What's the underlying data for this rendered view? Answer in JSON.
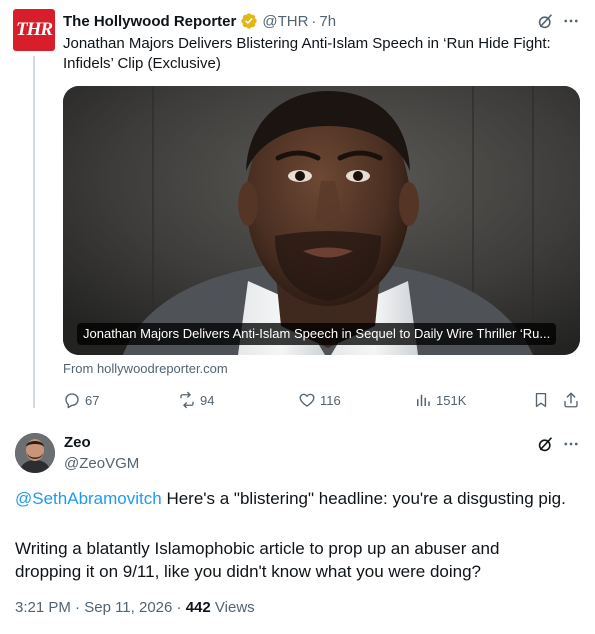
{
  "parent_tweet": {
    "avatar_text": "THR",
    "display_name": "The Hollywood Reporter",
    "handle": "@THR",
    "separator": "·",
    "time": "7h",
    "headline": "Jonathan Majors Delivers Blistering Anti-Islam Speech in ‘Run Hide Fight: Infidels’ Clip (Exclusive)",
    "card_caption": "Jonathan Majors Delivers Anti-Islam Speech in Sequel to Daily Wire Thriller ‘Ru...",
    "card_source": "From hollywoodreporter.com",
    "stats": {
      "replies": "67",
      "reposts": "94",
      "likes": "116",
      "views": "151K"
    }
  },
  "reply_tweet": {
    "display_name": "Zeo",
    "handle": "@ZeoVGM",
    "mention": "@SethAbramovitch",
    "line1_rest": " Here's a \"blistering\" headline: you're a disgusting pig.",
    "paragraph2": "Writing a blatantly Islamophobic article to prop up an abuser and dropping it on 9/11, like you didn't know what you were doing?",
    "time": "3:21 PM",
    "date": "Sep 11, 2026",
    "separator": "·",
    "views_count": "442",
    "views_label": "Views"
  },
  "colors": {
    "brand_red": "#d81e2b",
    "link_blue": "#1d9bf0",
    "verified_gold": "#e2b719",
    "muted": "#536471",
    "text": "#0f1419"
  }
}
